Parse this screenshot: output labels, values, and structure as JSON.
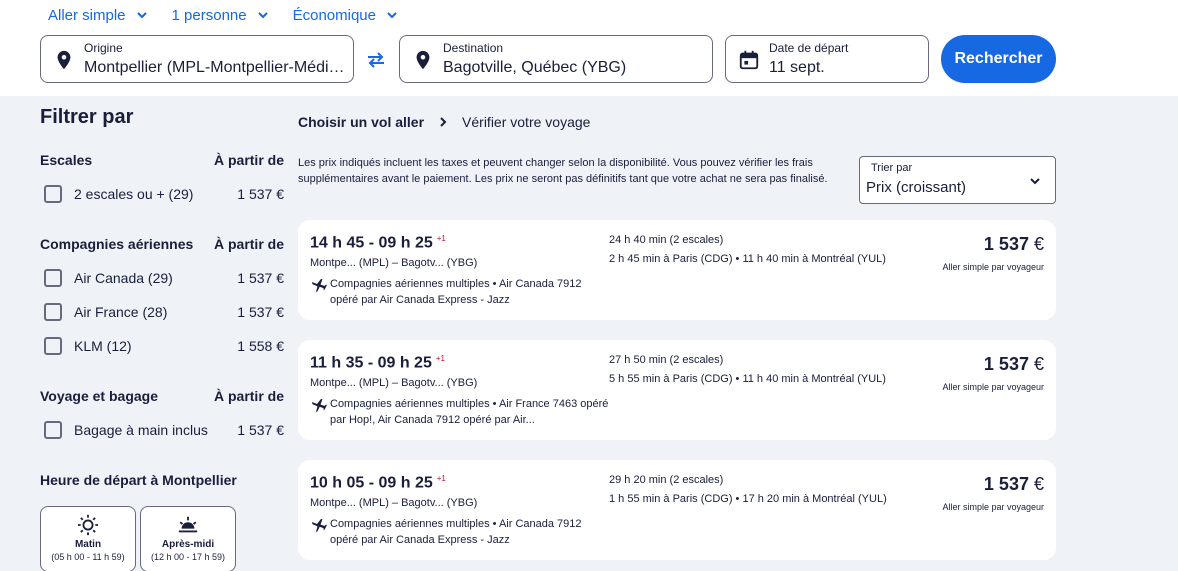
{
  "search_options": {
    "trip_type": "Aller simple",
    "travelers": "1 personne",
    "cabin": "Économique"
  },
  "origin": {
    "label": "Origine",
    "value": "Montpellier (MPL-Montpellier-Méditerranée)"
  },
  "destination": {
    "label": "Destination",
    "value": "Bagotville, Québec (YBG)"
  },
  "departure_date": {
    "label": "Date de départ",
    "value": "11 sept."
  },
  "search_button": "Rechercher",
  "filters": {
    "title": "Filtrer par",
    "from_label": "À partir de",
    "stops": {
      "title": "Escales",
      "items": [
        {
          "label": "2 escales ou + (29)",
          "price": "1 537 €"
        }
      ]
    },
    "airlines": {
      "title": "Compagnies aériennes",
      "items": [
        {
          "label": "Air Canada (29)",
          "price": "1 537 €"
        },
        {
          "label": "Air France (28)",
          "price": "1 537 €"
        },
        {
          "label": "KLM (12)",
          "price": "1 558 €"
        }
      ]
    },
    "baggage": {
      "title": "Voyage et bagage",
      "items": [
        {
          "label": "Bagage à main inclus",
          "price": "1 537 €"
        }
      ]
    },
    "departure_time": {
      "title": "Heure de départ à Montpellier",
      "tiles": [
        {
          "name": "Matin",
          "range": "(05 h 00 - 11 h 59)"
        },
        {
          "name": "Après-midi",
          "range": "(12 h 00 - 17 h 59)"
        }
      ]
    }
  },
  "breadcrumb": {
    "step1": "Choisir un vol aller",
    "step2": "Vérifier votre voyage"
  },
  "info_text": "Les prix indiqués incluent les taxes et peuvent changer selon la disponibilité. Vous pouvez vérifier les frais supplémentaires avant le paiement. Les prix ne seront pas définitifs tant que votre achat ne sera pas finalisé.",
  "sort": {
    "label": "Trier par",
    "value": "Prix (croissant)"
  },
  "flights": [
    {
      "times": "14 h 45 - 09 h 25",
      "day_offset": "+1",
      "route": "Montpe... (MPL) – Bagotv... (YBG)",
      "airlines": "Compagnies aériennes multiples • Air Canada 7912 opéré par Air Canada Express - Jazz",
      "duration": "24 h 40 min (2 escales)",
      "stops": "2 h 45 min à Paris (CDG) • 11 h 40 min à Montréal (YUL)",
      "price": "1 537",
      "currency": "€",
      "price_note": "Aller simple par voyageur"
    },
    {
      "times": "11 h 35 - 09 h 25",
      "day_offset": "+1",
      "route": "Montpe... (MPL) – Bagotv... (YBG)",
      "airlines": "Compagnies aériennes multiples • Air France 7463 opéré par Hop!, Air Canada 7912 opéré par Air...",
      "duration": "27 h 50 min (2 escales)",
      "stops": "5 h 55 min à Paris (CDG) • 11 h 40 min à Montréal (YUL)",
      "price": "1 537",
      "currency": "€",
      "price_note": "Aller simple par voyageur"
    },
    {
      "times": "10 h 05 - 09 h 25",
      "day_offset": "+1",
      "route": "Montpe... (MPL) – Bagotv... (YBG)",
      "airlines": "Compagnies aériennes multiples • Air Canada 7912 opéré par Air Canada Express - Jazz",
      "duration": "29 h 20 min (2 escales)",
      "stops": "1 h 55 min à Paris (CDG) • 17 h 20 min à Montréal (YUL)",
      "price": "1 537",
      "currency": "€",
      "price_note": "Aller simple par voyageur"
    }
  ],
  "colors": {
    "accent": "#1668e3",
    "text": "#191e3b",
    "background": "#eff3f7",
    "day_offset": "#c8102e"
  }
}
